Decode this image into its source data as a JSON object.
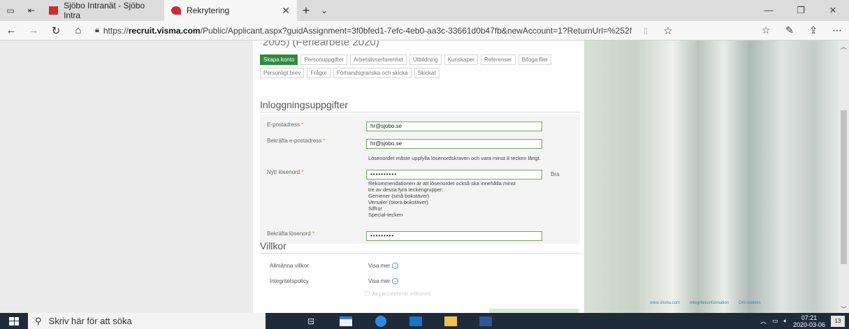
{
  "browser": {
    "tabs": [
      {
        "label": "Sjöbo Intranät - Sjöbo Intra"
      },
      {
        "label": "Rekrytering"
      }
    ],
    "url_prefix": "https://",
    "url_domain": "recruit.visma.com",
    "url_rest": "/Public/Applicant.aspx?guidAssignment=3f0bfed1-7efc-4eb0-aa3c-33661d0b47fb&newAccount=1?ReturnUrl=%252f"
  },
  "page": {
    "previous_title": "2005) (Feriearbete 2020)",
    "steps": [
      "Skapa konto",
      "Personuppgifter",
      "Arbetslivserfarenhet",
      "Utbildning",
      "Kunskaper",
      "Referenser",
      "Bifoga filer",
      "Personligt brev",
      "Frågor",
      "Förhandsgranska och skicka",
      "Skickat"
    ],
    "login_title": "Inloggningsuppgifter",
    "email_label": "E-postadress",
    "email_value": "hr@sjobo.se",
    "email_confirm_label": "Bekräfta e-postadress",
    "email_confirm_value": "hr@sjobo.se",
    "password_hint": "Lösenordet måste uppfylla lösenordskraven och vara minst 8 tecken långt.",
    "password_label": "Nytt lösenord",
    "password_value": "••••••••••",
    "password_strength": "Bra",
    "recommendation_lines": [
      "Rekommendationen är att lösenordet också ska innehålla minst",
      "tre av dessa fyra teckengrupper:",
      "Gemener (små bokstäver)",
      "Versaler (stora bokstäver)",
      "Siffror",
      "Special-tecken"
    ],
    "password_confirm_label": "Bekräfta lösenord",
    "password_confirm_value": "•••••••••",
    "terms_title": "Villkor",
    "terms_general_label": "Allmänna villkor",
    "terms_general_link": "Visa mer",
    "privacy_label": "Integritetspolicy",
    "privacy_link": "Visa mer",
    "accept_text": "Jag accepterar villkoren"
  },
  "footer": {
    "links": [
      "www.visma.com",
      "Integritetsinformation",
      "Om cookies"
    ]
  },
  "taskbar": {
    "search_placeholder": "Skriv här för att söka",
    "time": "07:21",
    "date": "2020-03-06",
    "notification_count": "13"
  }
}
